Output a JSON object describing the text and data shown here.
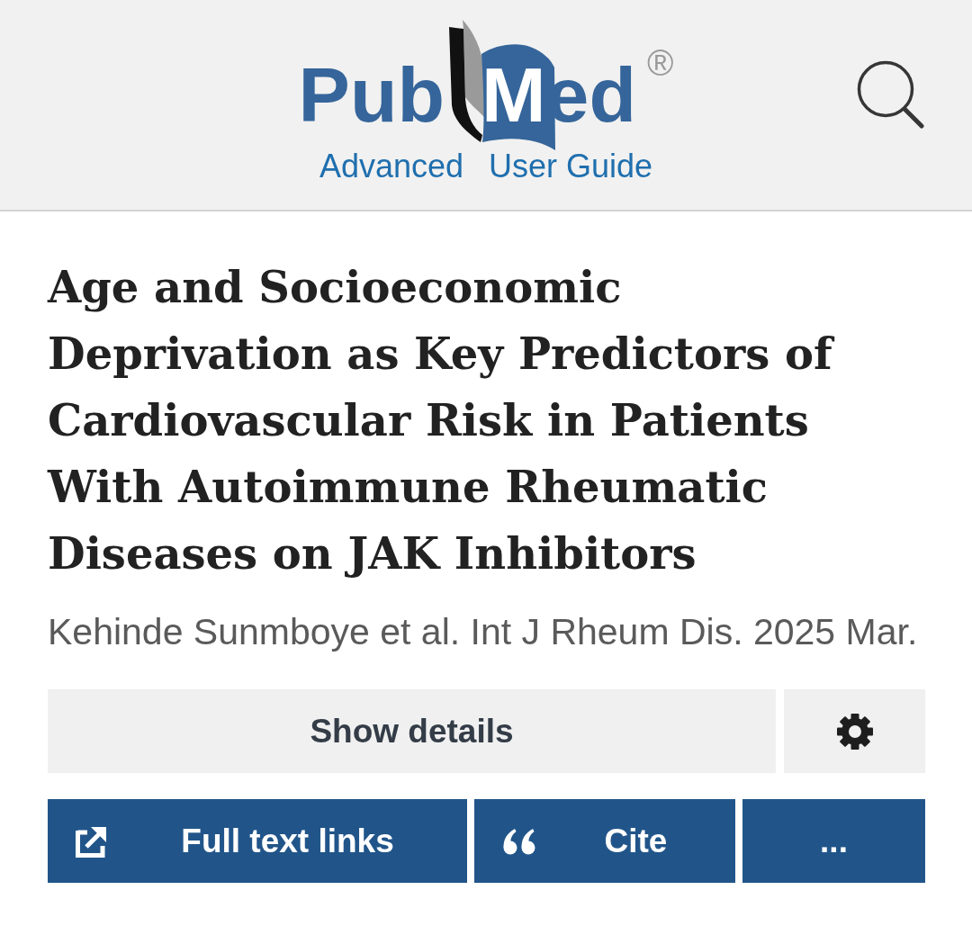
{
  "header": {
    "logo": {
      "left": "Pub",
      "right": "Med",
      "mark": "®"
    },
    "links": [
      "Advanced",
      "User Guide"
    ]
  },
  "article": {
    "title": "Age and Socioeconomic Deprivation as Key Predictors of Cardiovascular Risk in Patients With Autoimmune Rheumatic Diseases on JAK Inhibitors",
    "citation": "Kehinde Sunmboye et al. Int J Rheum Dis. 2025 Mar."
  },
  "details_button": {
    "label": "Show details"
  },
  "actions": [
    {
      "kind": "full_text",
      "label": "Full text links"
    },
    {
      "kind": "cite",
      "label": "Cite"
    },
    {
      "kind": "more",
      "label": "..."
    }
  ]
}
